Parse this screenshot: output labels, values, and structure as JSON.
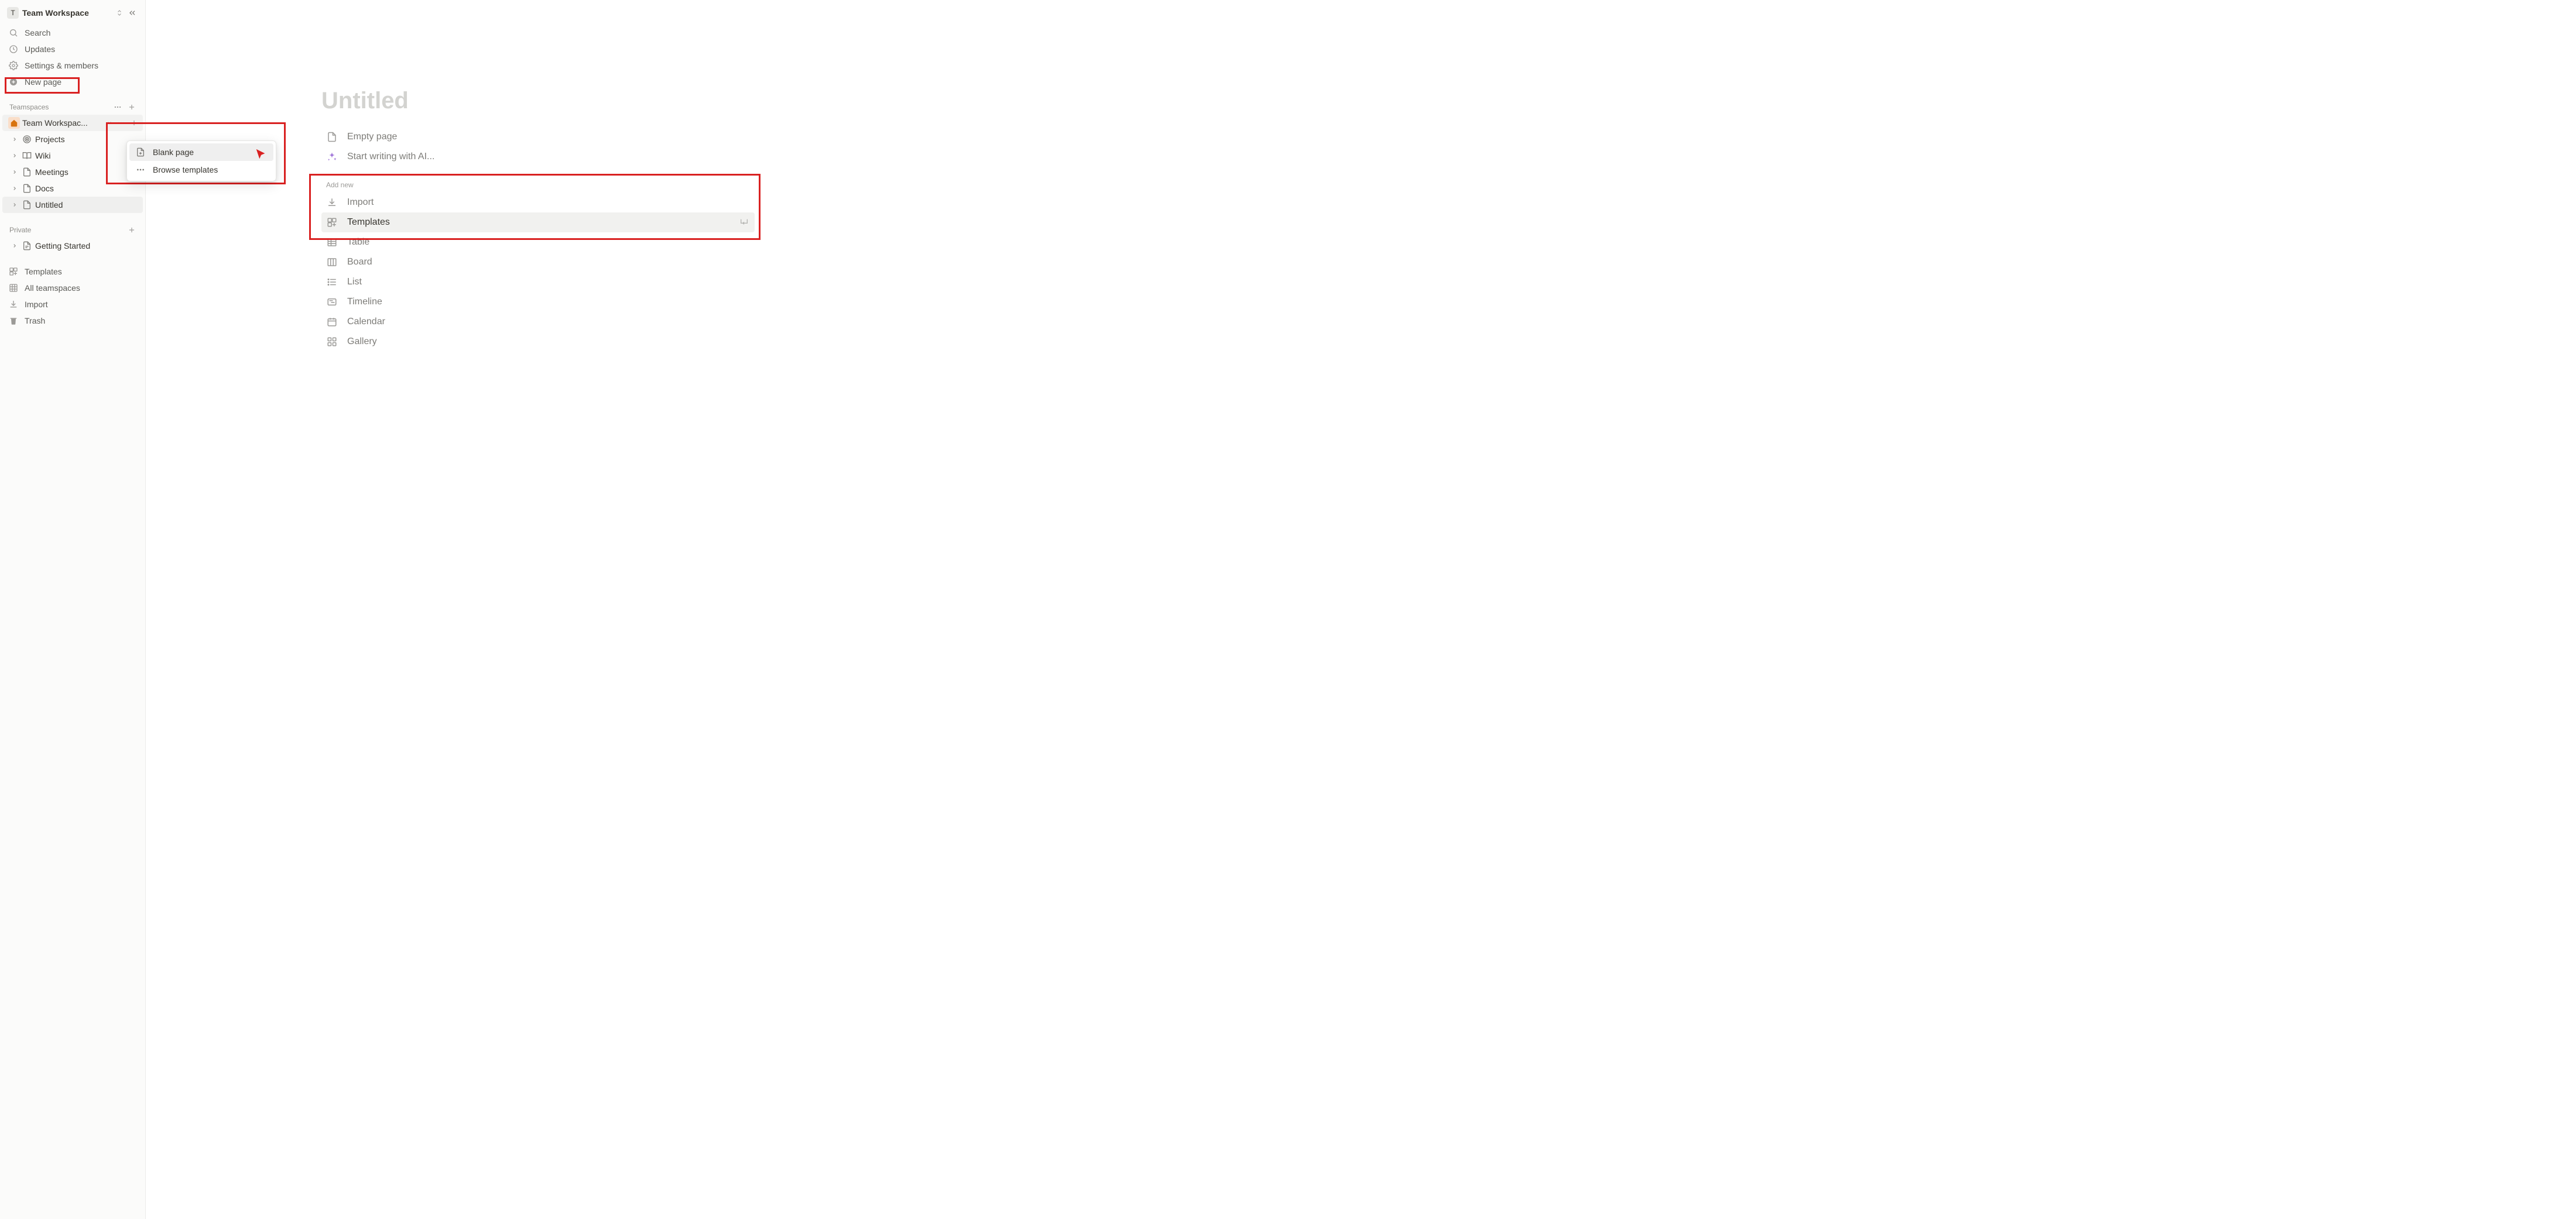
{
  "workspace": {
    "initial": "T",
    "name": "Team Workspace"
  },
  "sidebar_top": {
    "search": "Search",
    "updates": "Updates",
    "settings": "Settings & members",
    "new_page": "New page"
  },
  "sections": {
    "teamspaces": "Teamspaces",
    "private": "Private"
  },
  "teamspace": {
    "root": "Team Workspac...",
    "items": [
      {
        "label": "Projects"
      },
      {
        "label": "Wiki"
      },
      {
        "label": "Meetings"
      },
      {
        "label": "Docs"
      },
      {
        "label": "Untitled"
      }
    ]
  },
  "private_items": [
    {
      "label": "Getting Started"
    }
  ],
  "sidebar_bottom": {
    "templates": "Templates",
    "all_teamspaces": "All teamspaces",
    "import": "Import",
    "trash": "Trash"
  },
  "context_menu": {
    "blank_page": "Blank page",
    "browse_templates": "Browse templates"
  },
  "page": {
    "title_placeholder": "Untitled",
    "empty_page": "Empty page",
    "ai": "Start writing with AI...",
    "add_new": "Add new",
    "import": "Import",
    "templates": "Templates",
    "table": "Table",
    "board": "Board",
    "list": "List",
    "timeline": "Timeline",
    "calendar": "Calendar",
    "gallery": "Gallery"
  }
}
